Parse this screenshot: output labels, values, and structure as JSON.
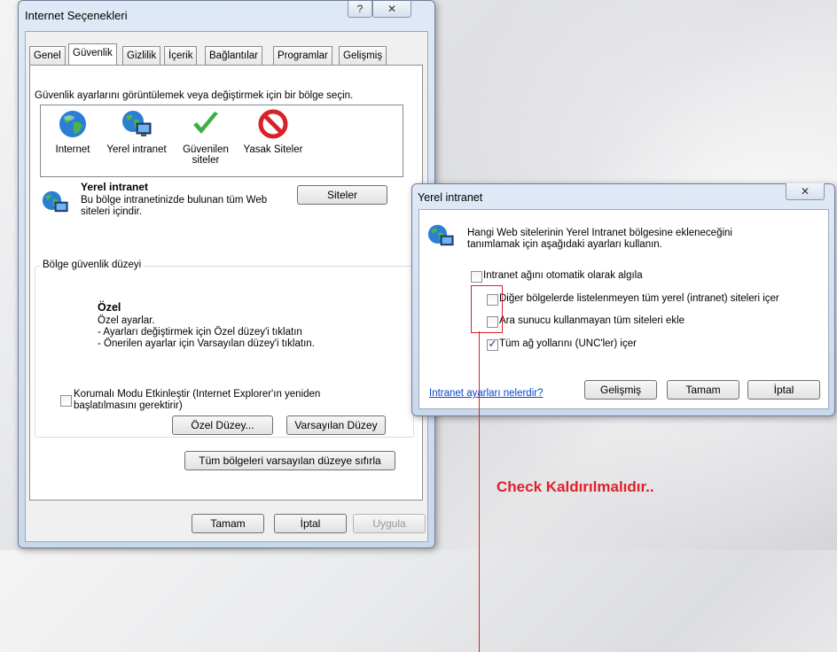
{
  "main_dialog": {
    "title": "Internet Seçenekleri",
    "help_button": "?",
    "close_button": "✕",
    "tabs": [
      {
        "label": "Genel"
      },
      {
        "label": "Güvenlik"
      },
      {
        "label": "Gizlilik"
      },
      {
        "label": "İçerik"
      },
      {
        "label": "Bağlantılar"
      },
      {
        "label": "Programlar"
      },
      {
        "label": "Gelişmiş"
      }
    ],
    "zone_prompt": "Güvenlik ayarlarını görüntülemek veya değiştirmek için bir bölge seçin.",
    "zones": [
      {
        "label": "Internet",
        "icon": "globe-icon"
      },
      {
        "label": "Yerel intranet",
        "icon": "intranet-icon"
      },
      {
        "label": "Güvenilen\nsiteler",
        "icon": "checkmark-icon"
      },
      {
        "label": "Yasak Siteler",
        "icon": "forbidden-icon"
      }
    ],
    "selected_zone_title": "Yerel intranet",
    "selected_zone_desc": "Bu bölge intranetinizde bulunan tüm Web siteleri içindir.",
    "sites_button": "Siteler",
    "security_level_group": "Bölge güvenlik düzeyi",
    "level_title": "Özel",
    "level_desc_1": "Özel ayarlar.",
    "level_desc_2": "- Ayarları değiştirmek için Özel düzey'i tıklatın",
    "level_desc_3": "- Önerilen ayarlar için Varsayılan düzey'i tıklatın.",
    "protected_mode_label": "Korumalı Modu Etkinleştir (Internet Explorer'ın yeniden başlatılmasını gerektirir)",
    "protected_mode_checked": false,
    "custom_level_button": "Özel Düzey...",
    "default_level_button": "Varsayılan Düzey",
    "reset_all_button": "Tüm bölgeleri varsayılan düzeye sıfırla",
    "ok_button": "Tamam",
    "cancel_button": "İptal",
    "apply_button": "Uygula"
  },
  "intranet_dialog": {
    "title": "Yerel intranet",
    "close_button": "✕",
    "intro": "Hangi Web sitelerinin Yerel Intranet bölgesine ekleneceğini tanımlamak için aşağıdaki ayarları kullanın.",
    "options": [
      {
        "label": "Intranet ağını otomatik olarak algıla",
        "checked": false
      },
      {
        "label": "Diğer bölgelerde listelenmeyen tüm yerel (intranet) siteleri içer",
        "checked": false
      },
      {
        "label": "Ara sunucu kullanmayan tüm siteleri ekle",
        "checked": false
      },
      {
        "label": "Tüm ağ yollarını (UNC'ler) içer",
        "checked": true
      }
    ],
    "help_link": "Intranet ayarları nelerdir?",
    "advanced_button": "Gelişmiş",
    "ok_button": "Tamam",
    "cancel_button": "İptal"
  },
  "annotation": {
    "text": "Check Kaldırılmalıdır..",
    "color": "#e0202a"
  }
}
